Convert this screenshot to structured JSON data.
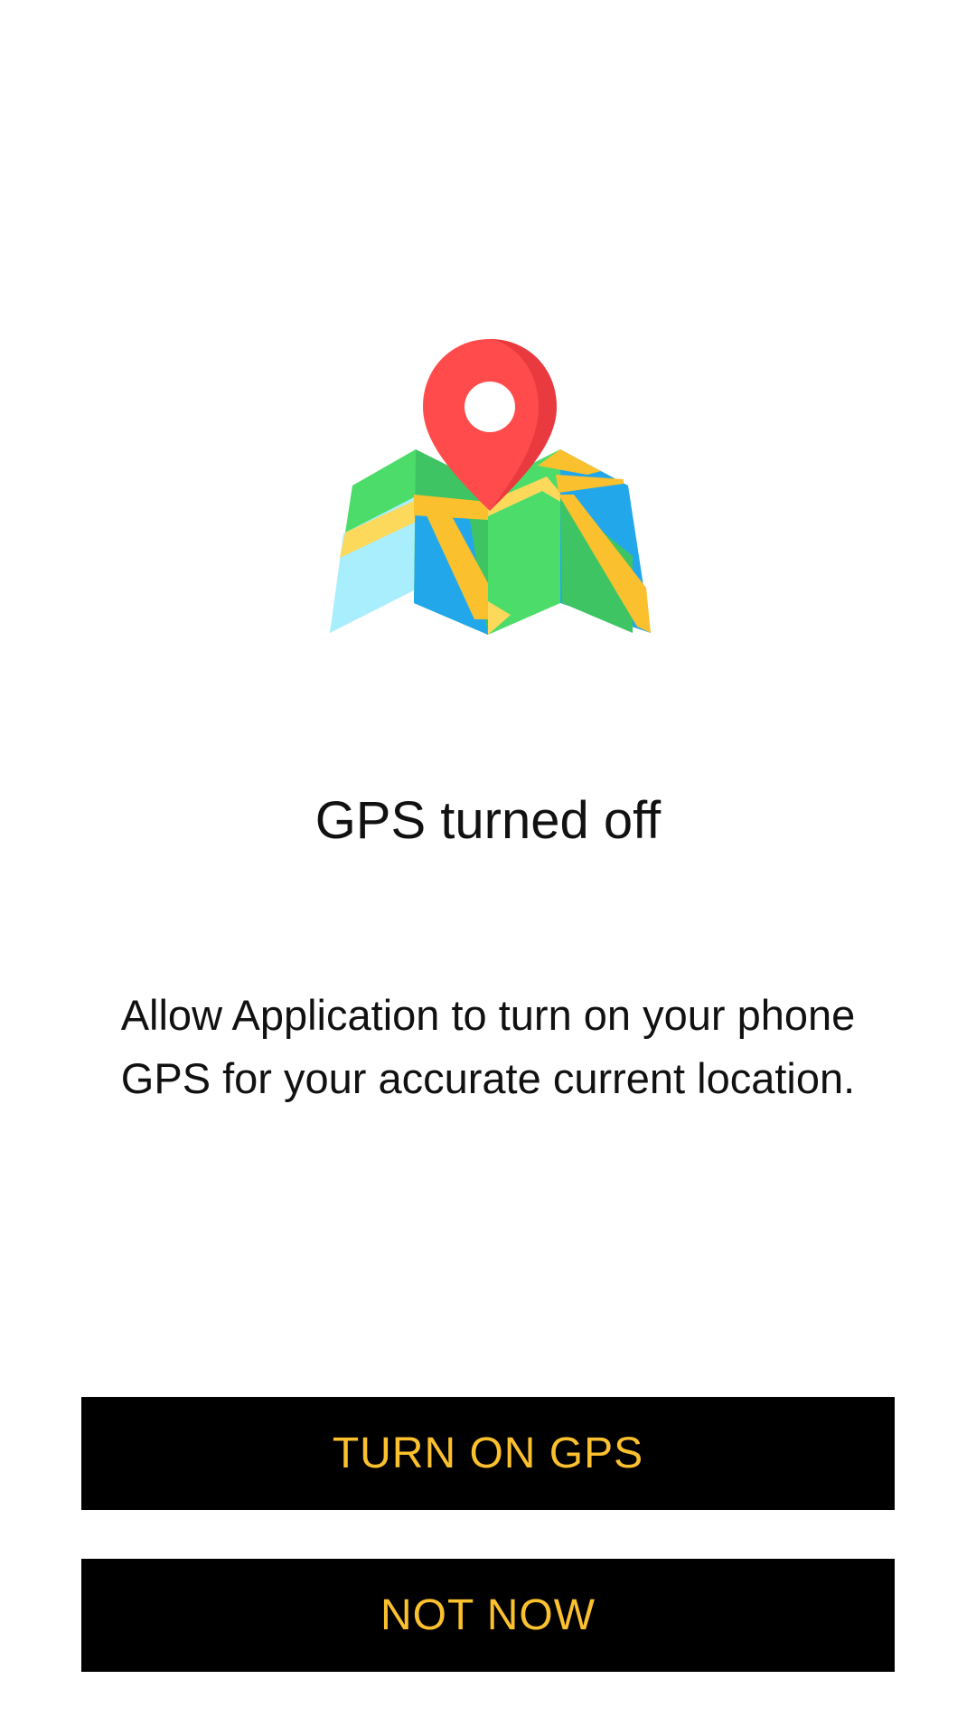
{
  "illustration": {
    "icon": "map-with-location-pin-icon",
    "colors": {
      "pin": "#FF4B4B",
      "pin_shade": "#E93A3F",
      "green": "#4CDC6A",
      "green_dark": "#3FC463",
      "blue": "#22A8EA",
      "light_blue": "#A9EEFC",
      "yellow": "#FBC02D",
      "light_yellow": "#FCD95B"
    }
  },
  "dialog": {
    "title": "GPS turned off",
    "description": "Allow Application to turn on your phone GPS for your accurate current location."
  },
  "actions": {
    "turn_on_label": "TURN ON GPS",
    "not_now_label": "NOT NOW"
  },
  "theme": {
    "button_background": "#000000",
    "button_text": "#FBC02D",
    "page_background": "#FFFFFF"
  }
}
